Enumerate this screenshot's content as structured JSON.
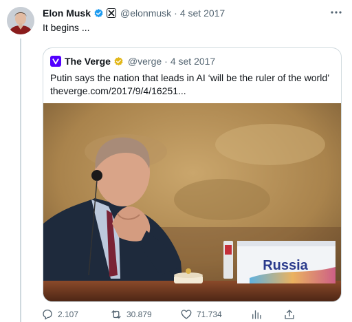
{
  "tweet": {
    "author_name": "Elon Musk",
    "author_handle": "@elonmusk",
    "separator": "·",
    "date": "4 set 2017",
    "text": "It begins ...",
    "icons": {
      "verified": "verified-badge-icon",
      "affiliate": "affiliate-x-icon",
      "more": "more-options-icon"
    }
  },
  "quote": {
    "source_name": "The Verge",
    "source_handle": "@verge",
    "separator": "·",
    "date": "4 set 2017",
    "headline": "Putin says the nation that leads in AI ‘will be the ruler of the world’",
    "link": "theverge.com/2017/9/4/16251...",
    "image_name_plate": "Russia",
    "icons": {
      "logo": "the-verge-logo-icon",
      "verified": "gold-verified-badge-icon"
    }
  },
  "actions": {
    "replies": "2.107",
    "reposts": "30.879",
    "likes": "71.734",
    "icons": [
      "reply-icon",
      "repost-icon",
      "like-icon",
      "views-icon",
      "share-icon"
    ]
  },
  "colors": {
    "text_primary": "#0f1419",
    "text_secondary": "#536471",
    "verified_blue": "#1d9bf0",
    "verified_gold": "#e2b719",
    "verge_purple": "#5200ff",
    "border": "#cfd9de"
  }
}
